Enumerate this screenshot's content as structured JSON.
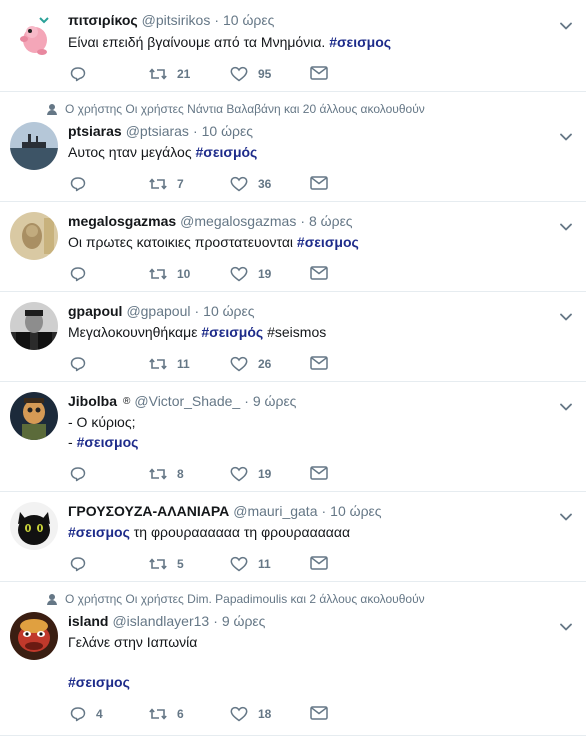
{
  "tweets": [
    {
      "name": "πιτσιρίκος",
      "handle": "@pitsirikos",
      "time": "10 ώρες",
      "lines": [
        [
          {
            "t": "Είναι επειδή βγαίνουμε από τα Μνημόνια. ",
            "h": false
          },
          {
            "t": "#σεισμος",
            "h": true
          }
        ]
      ],
      "replies": "",
      "retweets": "21",
      "likes": "95",
      "avatar": "pink-creature-avatar"
    },
    {
      "social": "Ο χρήστης Οι χρήστες Νάντια Βαλαβάνη και 20 άλλους ακολουθούν",
      "name": "ptsiaras",
      "handle": "@ptsiaras",
      "time": "10 ώρες",
      "lines": [
        [
          {
            "t": "Αυτος ηταν μεγάλος ",
            "h": false
          },
          {
            "t": "#σεισμός",
            "h": true
          }
        ]
      ],
      "replies": "",
      "retweets": "7",
      "likes": "36",
      "avatar": "ship-sea-avatar"
    },
    {
      "name": "megalosgazmas",
      "handle": "@megalosgazmas",
      "time": "8 ώρες",
      "lines": [
        [
          {
            "t": "Οι πρωτες κατοικιες προστατευονται ",
            "h": false
          },
          {
            "t": "#σεισμος",
            "h": true
          }
        ]
      ],
      "replies": "",
      "retweets": "10",
      "likes": "19",
      "avatar": "banknote-portrait-avatar"
    },
    {
      "name": "gpapoul",
      "handle": "@gpapoul",
      "time": "10 ώρες",
      "lines": [
        [
          {
            "t": "Μεγαλοκουνηθήκαμε ",
            "h": false
          },
          {
            "t": "#σεισμός",
            "h": true
          },
          {
            "t": " #seismos",
            "h": false
          }
        ]
      ],
      "replies": "",
      "retweets": "11",
      "likes": "26",
      "avatar": "bw-portrait-avatar"
    },
    {
      "name": "Jibolba",
      "verified_glyph": "®",
      "handle": "@Victor_Shade_",
      "time": "9 ώρες",
      "lines": [
        [
          {
            "t": "- Ο κύριος;",
            "h": false
          }
        ],
        [
          {
            "t": "- ",
            "h": false
          },
          {
            "t": "#σεισμος",
            "h": true
          }
        ]
      ],
      "replies": "",
      "retweets": "8",
      "likes": "19",
      "avatar": "goblin-avatar"
    },
    {
      "name": "ΓΡΟΥΣΟΥΖΑ-ΑΛΑΝΙΑΡΑ",
      "handle": "@mauri_gata",
      "time": "10 ώρες",
      "lines": [
        [
          {
            "t": "#σεισμος",
            "h": true
          },
          {
            "t": " τη φρουραααααα τη φρουραααααα",
            "h": false
          }
        ]
      ],
      "replies": "",
      "retweets": "5",
      "likes": "11",
      "avatar": "black-cat-avatar"
    },
    {
      "social": "Ο χρήστης Οι χρήστες Dim. Papadimoulis και 2 άλλους ακολουθούν",
      "name": "island",
      "handle": "@islandlayer13",
      "time": "9 ώρες",
      "lines": [
        [
          {
            "t": "Γελάνε στην Ιαπωνία",
            "h": false
          }
        ],
        [],
        [
          {
            "t": "#σεισμος",
            "h": true
          }
        ]
      ],
      "replies": "4",
      "retweets": "6",
      "likes": "18",
      "avatar": "muppet-animal-avatar"
    }
  ],
  "colors": {
    "hashtag": "#1d2b8a",
    "muted": "#657786",
    "divider": "#e6ecf0"
  }
}
